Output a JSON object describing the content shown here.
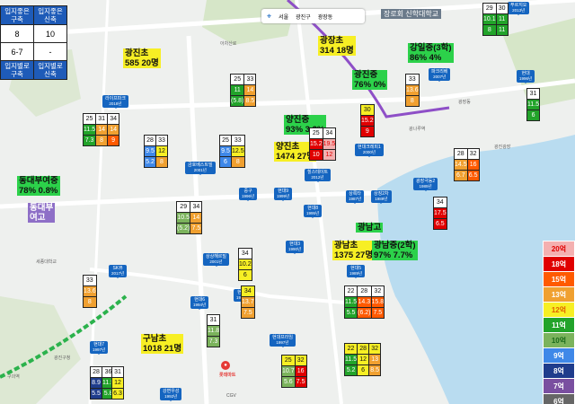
{
  "colors": {
    "c20": "#f4b0b0",
    "c18": "#e00000",
    "c15": "#ff5a00",
    "c13": "#f0a030",
    "c12": "#f7ef24",
    "c11": "#22a32a",
    "c10": "#7bb35c",
    "c9": "#3f88e8",
    "c8": "#1f3c8c",
    "c7": "#7a4fa0",
    "c6": "#666666",
    "none": "#ffffff"
  },
  "top_left_table": {
    "headers": [
      "입지좋은 구축",
      "입지좋은 신축",
      "입지별로 구축",
      "입지별로 신축"
    ],
    "values": [
      "8",
      "10",
      "6-7",
      "-"
    ]
  },
  "search_bar": {
    "items": [
      "서울",
      "광진구",
      "광장동"
    ]
  },
  "university_label": "장로회 신학대학교",
  "legend": [
    {
      "label": "20억",
      "color": "#f4b0b0",
      "text_color": "#e00000"
    },
    {
      "label": "18억",
      "color": "#e00000",
      "text_color": "#ffffff"
    },
    {
      "label": "15억",
      "color": "#ff5a00",
      "text_color": "#ffffff"
    },
    {
      "label": "13억",
      "color": "#f0a030",
      "text_color": "#ffffff"
    },
    {
      "label": "12억",
      "color": "#f7ef24",
      "text_color": "#e06000"
    },
    {
      "label": "11억",
      "color": "#22a32a",
      "text_color": "#ffffff"
    },
    {
      "label": "10억",
      "color": "#7bb35c",
      "text_color": "#1a6a1a"
    },
    {
      "label": "9억",
      "color": "#3f88e8",
      "text_color": "#ffffff"
    },
    {
      "label": "8억",
      "color": "#1f3c8c",
      "text_color": "#ffffff"
    },
    {
      "label": "7억",
      "color": "#7a4fa0",
      "text_color": "#ffffff"
    },
    {
      "label": "6억",
      "color": "#666666",
      "text_color": "#ffffff"
    }
  ],
  "schools": [
    {
      "id": "gwangjin-el",
      "text": "광진초\n585 20명",
      "style": "y"
    },
    {
      "id": "gwangjang-el",
      "text": "광장초\n314 18명",
      "style": "y"
    },
    {
      "id": "gwangil-mid",
      "text": "강일중(3학)\n86% 4%",
      "style": "g"
    },
    {
      "id": "gwangjin-mid",
      "text": "광진중\n76% 0%",
      "style": "g"
    },
    {
      "id": "yangjin-mid",
      "text": "양진중\n93% 3.3%",
      "style": "g"
    },
    {
      "id": "yangjin-el",
      "text": "양진초\n1474 27명",
      "style": "y"
    },
    {
      "id": "dongdaebu-mid",
      "text": "동대부여중\n78% 0.8%",
      "style": "g"
    },
    {
      "id": "dongdaebu-high",
      "text": "동대부\n여고",
      "style": "p"
    },
    {
      "id": "gwangnam-el",
      "text": "광남초\n1375 27명",
      "style": "y"
    },
    {
      "id": "gwangnam-mid",
      "text": "광남중(2학)\n97% 7.7%",
      "style": "g"
    },
    {
      "id": "gwangnam-high",
      "text": "광남고",
      "style": "g"
    },
    {
      "id": "gunam-el",
      "text": "구남초\n1018 21명",
      "style": "y"
    }
  ],
  "apartments": [
    {
      "name": "라이프파크",
      "year": "2018년"
    },
    {
      "name": "금호베스트빌",
      "year": "2001년"
    },
    {
      "name": "현대",
      "year": "1996년"
    },
    {
      "name": "파크리베",
      "year": "2007년"
    },
    {
      "name": "현대크레피1",
      "year": "2000년"
    },
    {
      "name": "힐스테이트",
      "year": "2012년"
    },
    {
      "name": "광장극동2",
      "year": "1989년"
    },
    {
      "name": "중구",
      "year": "1996년"
    },
    {
      "name": "현대9",
      "year": "1999년"
    },
    {
      "name": "상록타",
      "year": "1987년"
    },
    {
      "name": "상징2차",
      "year": "1989년"
    },
    {
      "name": "현대8",
      "year": "1995년"
    },
    {
      "name": "현대3",
      "year": "1990년"
    },
    {
      "name": "상상해르빌",
      "year": "2001년"
    },
    {
      "name": "SK뷰",
      "year": "2017년"
    },
    {
      "name": "현대5",
      "year": "1989년"
    },
    {
      "name": "현대6",
      "year": "1994년"
    },
    {
      "name": "현대2",
      "year": "1992년"
    },
    {
      "name": "현대7",
      "year": "1997년"
    },
    {
      "name": "현대프라임",
      "year": "1997년"
    },
    {
      "name": "강변우성",
      "year": "1992년"
    },
    {
      "name": "푸르지오",
      "year": "2013년"
    }
  ],
  "price_grids": [
    {
      "id": "g-lifepark",
      "rows": [
        [
          "25",
          "31",
          "34"
        ],
        [
          "11.5",
          "14",
          "14"
        ],
        [
          "7.3",
          "8",
          "9"
        ]
      ],
      "colors": [
        [
          "none",
          "none",
          "none"
        ],
        [
          "c11",
          "c13",
          "c13"
        ],
        [
          "c11",
          "c13",
          "c15"
        ]
      ]
    },
    {
      "id": "g-geumho",
      "rows": [
        [
          "28",
          "33"
        ],
        [
          "9.5",
          "12"
        ],
        [
          "5.2",
          "8"
        ]
      ],
      "colors": [
        [
          "none",
          "none"
        ],
        [
          "c9",
          "c12"
        ],
        [
          "c9",
          "c13"
        ]
      ]
    },
    {
      "id": "g-gumho2",
      "rows": [
        [
          "25",
          "33"
        ],
        [
          "9.5",
          "12.5"
        ],
        [
          "6",
          "8"
        ]
      ],
      "colors": [
        [
          "none",
          "none"
        ],
        [
          "c9",
          "c12"
        ],
        [
          "c9",
          "c13"
        ]
      ]
    },
    {
      "id": "g-hyundai-top",
      "rows": [
        [
          "25",
          "33"
        ],
        [
          "11",
          "14"
        ],
        [
          "(5.8)",
          "8.5"
        ]
      ],
      "colors": [
        [
          "none",
          "none"
        ],
        [
          "c11",
          "c13"
        ],
        [
          "c11",
          "c13"
        ]
      ]
    },
    {
      "id": "g-parkriver",
      "rows": [
        [
          "33"
        ],
        [
          "13.6"
        ],
        [
          "8"
        ]
      ],
      "colors": [
        [
          "none"
        ],
        [
          "c13"
        ],
        [
          "c13"
        ]
      ]
    },
    {
      "id": "g-topright",
      "rows": [
        [
          "29",
          "30"
        ],
        [
          "10.1",
          "11"
        ],
        [
          "8",
          "11"
        ]
      ],
      "colors": [
        [
          "none",
          "none"
        ],
        [
          "c11",
          "c11"
        ],
        [
          "c11",
          "c11"
        ]
      ]
    },
    {
      "id": "g-hyundai96",
      "rows": [
        [
          "31"
        ],
        [
          "11.5"
        ],
        [
          "6"
        ]
      ],
      "colors": [
        [
          "none"
        ],
        [
          "c11"
        ],
        [
          "c11"
        ]
      ]
    },
    {
      "id": "g-crepe",
      "rows": [
        [
          "30"
        ],
        [
          "15.2"
        ],
        [
          "9"
        ]
      ],
      "colors": [
        [
          "c12"
        ],
        [
          "c18"
        ],
        [
          "c18"
        ]
      ]
    },
    {
      "id": "g-hillstate",
      "rows": [
        [
          "25",
          "34"
        ],
        [
          "15.2",
          "19.5"
        ],
        [
          "10",
          "12"
        ]
      ],
      "colors": [
        [
          "none",
          "none"
        ],
        [
          "c18",
          "c20"
        ],
        [
          "c18",
          "c20"
        ]
      ]
    },
    {
      "id": "g-geukdong",
      "rows": [
        [
          "28",
          "32"
        ],
        [
          "14.5",
          "16"
        ],
        [
          "6.7",
          "6.5"
        ]
      ],
      "colors": [
        [
          "none",
          "none"
        ],
        [
          "c13",
          "c15"
        ],
        [
          "c13",
          "c15"
        ]
      ]
    },
    {
      "id": "g-dongdaebu",
      "rows": [
        [
          "29",
          "34"
        ],
        [
          "10.5",
          "14"
        ],
        [
          "(5.2)",
          "7.5"
        ]
      ],
      "colors": [
        [
          "none",
          "none"
        ],
        [
          "c10",
          "c13"
        ],
        [
          "c10",
          "c13"
        ]
      ]
    },
    {
      "id": "g-hyundai3",
      "rows": [
        [
          "34"
        ],
        [
          "17.5"
        ],
        [
          "6.5"
        ]
      ],
      "colors": [
        [
          "none"
        ],
        [
          "c18"
        ],
        [
          "c18"
        ]
      ]
    },
    {
      "id": "g-sangsang",
      "rows": [
        [
          "34"
        ],
        [
          "10.2"
        ],
        [
          "6"
        ]
      ],
      "colors": [
        [
          "none"
        ],
        [
          "c12"
        ],
        [
          "c12"
        ]
      ]
    },
    {
      "id": "g-skview",
      "rows": [
        [
          "33"
        ],
        [
          "13.6"
        ],
        [
          "8"
        ]
      ],
      "colors": [
        [
          "none"
        ],
        [
          "c13"
        ],
        [
          "c13"
        ]
      ]
    },
    {
      "id": "g-hyundai5",
      "rows": [
        [
          "22",
          "28",
          "32"
        ],
        [
          "11.5",
          "14.3",
          "15.8"
        ],
        [
          "5.5",
          "(6.2)",
          "7.5"
        ]
      ],
      "colors": [
        [
          "none",
          "none",
          "none"
        ],
        [
          "c11",
          "c15",
          "c15"
        ],
        [
          "c11",
          "c15",
          "c15"
        ]
      ]
    },
    {
      "id": "g-hyundai2",
      "rows": [
        [
          "34"
        ],
        [
          "13.7"
        ],
        [
          "7.5"
        ]
      ],
      "colors": [
        [
          "c12"
        ],
        [
          "c13"
        ],
        [
          "c13"
        ]
      ]
    },
    {
      "id": "g-hyundai6",
      "rows": [
        [
          "31"
        ],
        [
          "11.8"
        ],
        [
          "7.3"
        ]
      ],
      "colors": [
        [
          "none"
        ],
        [
          "c10"
        ],
        [
          "c10"
        ]
      ]
    },
    {
      "id": "g-prime",
      "rows": [
        [
          "22",
          "28",
          "32"
        ],
        [
          "11.5",
          "12",
          "13"
        ],
        [
          "5.2",
          "6",
          "8.5"
        ]
      ],
      "colors": [
        [
          "c12",
          "c12",
          "c12"
        ],
        [
          "c11",
          "c12",
          "c13"
        ],
        [
          "c11",
          "c12",
          "c13"
        ]
      ]
    },
    {
      "id": "g-prime2",
      "rows": [
        [
          "25",
          "32"
        ],
        [
          "10.7",
          "16"
        ],
        [
          "5.6",
          "7.5"
        ]
      ],
      "colors": [
        [
          "c12",
          "c12"
        ],
        [
          "c10",
          "c18"
        ],
        [
          "c10",
          "c18"
        ]
      ]
    },
    {
      "id": "g-hyundai7",
      "rows": [
        [
          "28",
          "36"
        ],
        [
          "8.9",
          "11.5"
        ],
        [
          "5.5",
          "5.8"
        ]
      ],
      "colors": [
        [
          "none",
          "none"
        ],
        [
          "c8",
          "c11"
        ],
        [
          "c8",
          "c11"
        ]
      ]
    },
    {
      "id": "g-gangbyeon",
      "rows": [
        [
          "31"
        ],
        [
          "12"
        ],
        [
          "6.3"
        ]
      ],
      "colors": [
        [
          "none"
        ],
        [
          "c12"
        ],
        [
          "c12"
        ]
      ]
    }
  ],
  "map_labels": [
    "구의역",
    "광진구청",
    "광장동",
    "세종대학교",
    "아차산로",
    "광나루역",
    "광진광장"
  ],
  "misc": {
    "mart": "롯데마트",
    "cgv": "CGV"
  }
}
